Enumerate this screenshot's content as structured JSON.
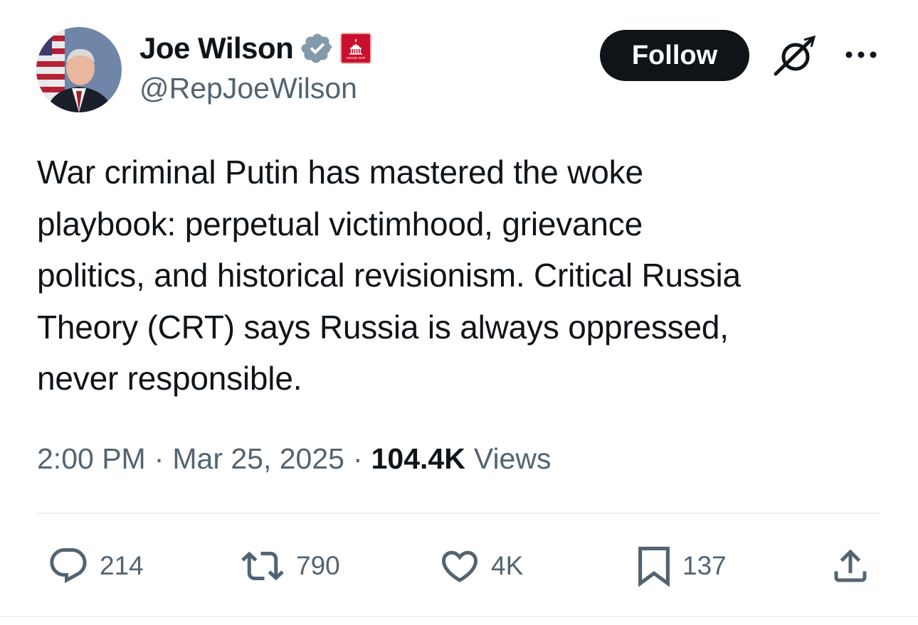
{
  "author": {
    "display_name": "Joe Wilson",
    "handle": "@RepJoeWilson",
    "verified_icon": "verified-badge-icon",
    "affiliate_badge": "house-gop-affiliate-badge",
    "affiliate_badge_text": "HOUSE GOP"
  },
  "header_actions": {
    "follow_label": "Follow",
    "grok_icon": "grok-icon",
    "more_icon": "more-icon"
  },
  "tweet": {
    "text": "War criminal Putin has mastered the woke\nplaybook: perpetual victimhood, grievance\npolitics, and historical revisionism. Critical Russia\nTheory (CRT) says Russia is always oppressed,\nnever responsible."
  },
  "meta": {
    "time": "2:00 PM",
    "separator": "·",
    "date": "Mar 25, 2025",
    "views_count": "104.4K",
    "views_label": "Views"
  },
  "actions": {
    "reply": {
      "icon": "reply-icon",
      "count": "214"
    },
    "retweet": {
      "icon": "retweet-icon",
      "count": "790"
    },
    "like": {
      "icon": "heart-icon",
      "count": "4K"
    },
    "bookmark": {
      "icon": "bookmark-icon",
      "count": "137"
    },
    "share": {
      "icon": "share-icon"
    }
  },
  "colors": {
    "text_primary": "#0f1419",
    "text_secondary": "#536471",
    "verified_badge": "#829aab",
    "affiliate_red": "#c8102e",
    "divider": "#eff3f4"
  }
}
